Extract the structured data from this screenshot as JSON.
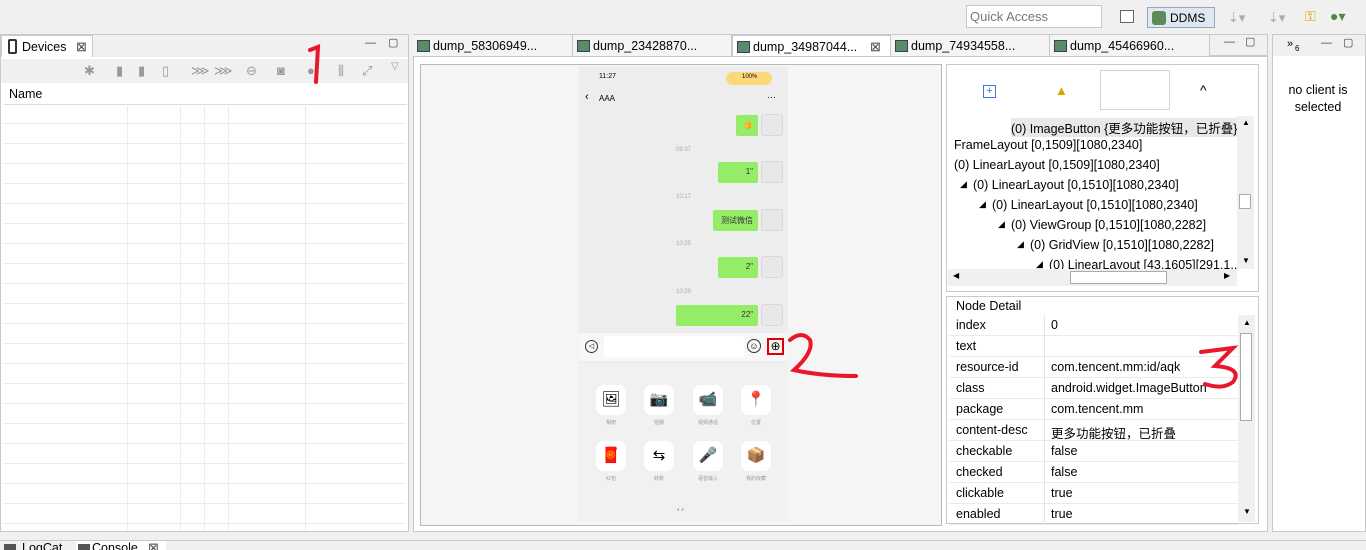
{
  "top_toolbar": {
    "quick_access_placeholder": "Quick Access",
    "ddms_label": "DDMS"
  },
  "devices_view": {
    "tab_label": "Devices",
    "column_name": "Name"
  },
  "editor_tabs": [
    {
      "label": "dump_58306949..."
    },
    {
      "label": "dump_23428870..."
    },
    {
      "label": "dump_34987044..."
    },
    {
      "label": "dump_74934558..."
    },
    {
      "label": "dump_45466960..."
    }
  ],
  "overflow_tab": {
    "count": "6"
  },
  "phone": {
    "status_time": "11:27",
    "battery": "100%",
    "chat_title": "AAA",
    "menu": "···",
    "messages": [
      {
        "text": "👍"
      },
      {
        "time": "09:37"
      },
      {
        "text": "1\""
      },
      {
        "time": "10:17"
      },
      {
        "text": "测试微信"
      },
      {
        "time": "10:25"
      },
      {
        "text": "2\""
      },
      {
        "time": "10:29"
      },
      {
        "text": "22\""
      }
    ],
    "panel_items": [
      {
        "icon": "🖼",
        "label": "相册"
      },
      {
        "icon": "📷",
        "label": "拍摄"
      },
      {
        "icon": "📹",
        "label": "视频通话"
      },
      {
        "icon": "📍",
        "label": "位置"
      },
      {
        "icon": "🧧",
        "label": "红包"
      },
      {
        "icon": "⇆",
        "label": "转账"
      },
      {
        "icon": "🎤",
        "label": "语音输入"
      },
      {
        "icon": "📦",
        "label": "我的收藏"
      }
    ]
  },
  "hierarchy": {
    "nodes": [
      {
        "text": "(0) ImageButton {更多功能按钮，已折叠}"
      },
      {
        "text": "FrameLayout [0,1509][1080,2340]"
      },
      {
        "text": "(0) LinearLayout [0,1509][1080,2340]"
      },
      {
        "text": "(0) LinearLayout [0,1510][1080,2340]"
      },
      {
        "text": "(0) LinearLayout [0,1510][1080,2340]"
      },
      {
        "text": "(0) ViewGroup [0,1510][1080,2282]"
      },
      {
        "text": "(0) GridView [0,1510][1080,2282]"
      },
      {
        "text": "(0) LinearLayout [43,1605][291,1..."
      }
    ]
  },
  "node_detail": {
    "title": "Node Detail",
    "rows": [
      {
        "key": "index",
        "value": "0"
      },
      {
        "key": "text",
        "value": ""
      },
      {
        "key": "resource-id",
        "value": "com.tencent.mm:id/aqk"
      },
      {
        "key": "class",
        "value": "android.widget.ImageButton"
      },
      {
        "key": "package",
        "value": "com.tencent.mm"
      },
      {
        "key": "content-desc",
        "value": "更多功能按钮，已折叠"
      },
      {
        "key": "checkable",
        "value": "false"
      },
      {
        "key": "checked",
        "value": "false"
      },
      {
        "key": "clickable",
        "value": "true"
      },
      {
        "key": "enabled",
        "value": "true"
      }
    ]
  },
  "right_view": {
    "message": "no client is selected"
  },
  "bottom_tabs": [
    {
      "label": "LogCat"
    },
    {
      "label": "Console"
    }
  ],
  "annotations": [
    "1",
    "2",
    "3"
  ],
  "colors": {
    "accent_green": "#95ec69",
    "annotation_red": "#e8172c",
    "highlight_border": "#e00000"
  }
}
